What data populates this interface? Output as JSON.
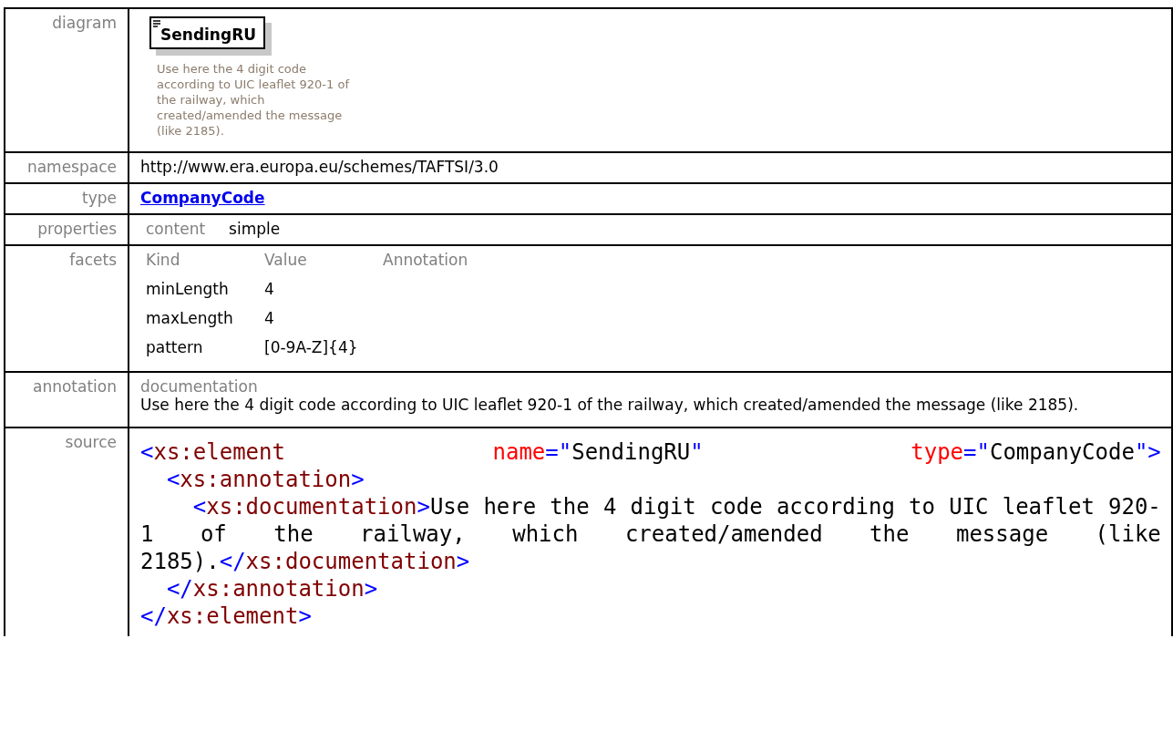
{
  "rows": [
    {
      "kind": "diagram",
      "label": "diagram",
      "element_name": "SendingRU",
      "annotation": "Use here the 4 digit code according to UIC leaflet 920-1 of the railway, which created/amended the message (like 2185)."
    },
    {
      "kind": "text",
      "label": "namespace",
      "value": "http://www.era.europa.eu/schemes/TAFTSI/3.0"
    },
    {
      "kind": "link",
      "label": "type",
      "value": "CompanyCode"
    },
    {
      "kind": "properties",
      "label": "properties",
      "pairs": [
        {
          "key": "content",
          "value": "simple"
        }
      ]
    },
    {
      "kind": "facets",
      "label": "facets",
      "columns": [
        "Kind",
        "Value",
        "Annotation"
      ],
      "facet_rows": [
        [
          "minLength",
          "4"
        ],
        [
          "maxLength",
          "4"
        ],
        [
          "pattern",
          "[0-9A-Z]{4}"
        ]
      ]
    },
    {
      "kind": "annotation",
      "label": "annotation",
      "heading": "documentation",
      "text": "Use here the 4 digit code according to UIC leaflet 920-1 of the railway, which created/amended the message (like 2185)."
    },
    {
      "kind": "source",
      "label": "source",
      "lines": [
        {
          "tokens": [
            {
              "kind": "bracket",
              "text": "<"
            },
            {
              "kind": "tag",
              "text": "xs:element"
            },
            {
              "kind": "attr",
              "text": "name"
            },
            {
              "kind": "bracket",
              "text": "=\""
            },
            {
              "kind": "value",
              "text": "SendingRU"
            },
            {
              "kind": "bracket",
              "text": "\""
            },
            {
              "kind": "attr",
              "text": "type"
            },
            {
              "kind": "bracket",
              "text": "=\""
            },
            {
              "kind": "value",
              "text": "CompanyCode"
            },
            {
              "kind": "bracket",
              "text": "\">"
            }
          ],
          "children": [
            {
              "tokens": [
                {
                  "kind": "bracket",
                  "text": "<"
                },
                {
                  "kind": "tag",
                  "text": "xs:annotation"
                },
                {
                  "kind": "bracket",
                  "text": ">"
                }
              ],
              "children": [
                {
                  "tokens": [
                    {
                      "kind": "bracket",
                      "text": "<"
                    },
                    {
                      "kind": "tag",
                      "text": "xs:documentation"
                    },
                    {
                      "kind": "bracket",
                      "text": ">"
                    },
                    {
                      "kind": "value",
                      "text": "Use here the 4 digit code according to UIC leaflet 920-1 of the railway, which created/amended the message (like 2185)."
                    },
                    {
                      "kind": "bracket",
                      "text": "</"
                    },
                    {
                      "kind": "tag",
                      "text": "xs:documentation"
                    },
                    {
                      "kind": "bracket",
                      "text": ">"
                    }
                  ]
                }
              ]
            },
            {
              "tokens": [
                {
                  "kind": "bracket",
                  "text": "</"
                },
                {
                  "kind": "tag",
                  "text": "xs:annotation"
                },
                {
                  "kind": "bracket",
                  "text": ">"
                }
              ]
            }
          ]
        },
        {
          "tokens": [
            {
              "kind": "bracket",
              "text": "</"
            },
            {
              "kind": "tag",
              "text": "xs:element"
            },
            {
              "kind": "bracket",
              "text": ">"
            }
          ]
        }
      ]
    }
  ]
}
